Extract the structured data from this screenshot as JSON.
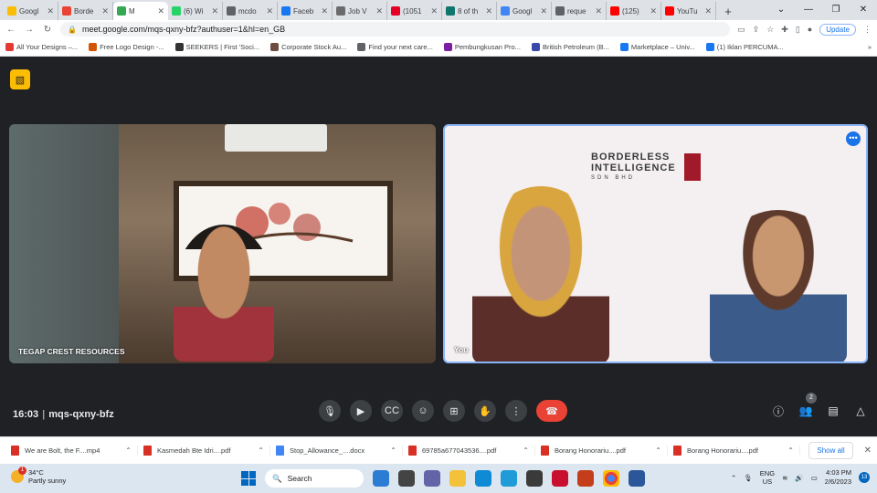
{
  "browser": {
    "tabs": [
      {
        "label": "Googl",
        "color": "#fbbc04"
      },
      {
        "label": "Borde",
        "color": "#ea4335"
      },
      {
        "label": "M",
        "color": "#34a853",
        "active": true
      },
      {
        "label": "(6) Wi",
        "color": "#25d366"
      },
      {
        "label": "mcdo",
        "color": "#5f6368"
      },
      {
        "label": "Faceb",
        "color": "#1877f2"
      },
      {
        "label": "Job V",
        "color": "#6b6b6b"
      },
      {
        "label": "(1051",
        "color": "#e60023"
      },
      {
        "label": "8 of th",
        "color": "#0f766e"
      },
      {
        "label": "Googl",
        "color": "#4285f4"
      },
      {
        "label": "reque",
        "color": "#5f6368"
      },
      {
        "label": "(125)",
        "color": "#ff0000"
      },
      {
        "label": "YouTu",
        "color": "#ff0000"
      }
    ],
    "url": "meet.google.com/mqs-qxny-bfz?authuser=1&hl=en_GB",
    "update_label": "Update",
    "bookmarks": [
      "All Your Designs –...",
      "Free Logo Design -...",
      "SEEKERS | First 'Soci...",
      "Corporate Stock Au...",
      "Find your next care...",
      "Pembungkusan Pro...",
      "British Petroleum (B...",
      "Marketplace – Univ...",
      "(1) Iklan PERCUMA..."
    ]
  },
  "meet": {
    "participants": [
      {
        "name": "TEGAP CREST RESOURCES"
      },
      {
        "name": "You"
      }
    ],
    "logo": {
      "line1": "BORDERLESS",
      "line2": "INTELLIGENCE",
      "line3": "SDN BHD"
    },
    "time": "16:03",
    "meeting_code": "mqs-qxny-bfz",
    "people_count": "2"
  },
  "downloads": {
    "items": [
      {
        "label": "We are Bolt, the F....mp4",
        "type": "pdf"
      },
      {
        "label": "Kasmedah Bte Idri....pdf",
        "type": "pdf"
      },
      {
        "label": "Stop_Allowance_....docx",
        "type": "doc"
      },
      {
        "label": "69785a677043536....pdf",
        "type": "pdf"
      },
      {
        "label": "Borang Honorariu....pdf",
        "type": "pdf"
      },
      {
        "label": "Borang Honorariu....pdf",
        "type": "pdf"
      }
    ],
    "show_all": "Show all"
  },
  "taskbar": {
    "temp": "34°C",
    "weather": "Partly sunny",
    "weather_badge": "1",
    "search": "Search",
    "lang": "ENG",
    "region": "US",
    "time": "4:03 PM",
    "date": "2/6/2023",
    "notif": "13"
  }
}
